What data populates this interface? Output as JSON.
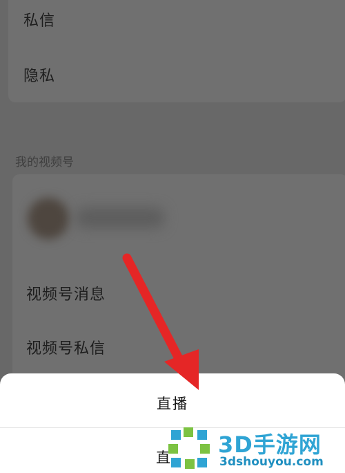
{
  "settings": {
    "privacy_rows": [
      "私信",
      "隐私"
    ],
    "channel_section_title": "我的视频号",
    "channel_rows": [
      "视频号消息",
      "视频号私信"
    ]
  },
  "bottom_sheet": {
    "options": [
      "直播",
      "直"
    ]
  },
  "annotation": {
    "arrow_color": "#e52626"
  },
  "watermark": {
    "title": "3D手游网",
    "url": "3dshouyou.com"
  }
}
